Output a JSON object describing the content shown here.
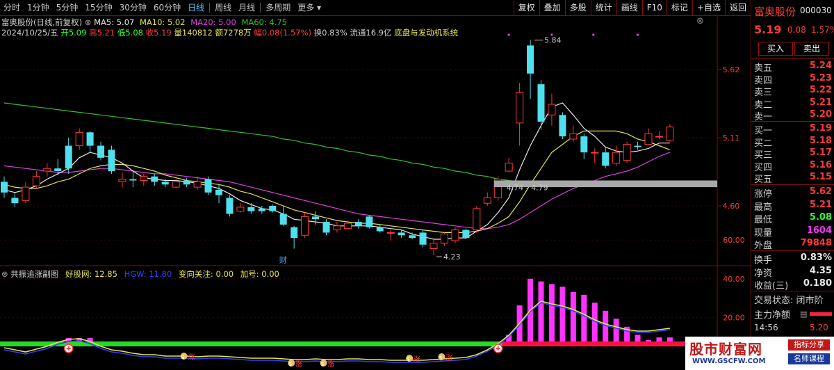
{
  "toolbar": {
    "periods": [
      "分时",
      "1分钟",
      "5分钟",
      "15分钟",
      "30分钟",
      "60分钟",
      "日线",
      "周线",
      "月线",
      "多周期",
      "更多 ▾"
    ],
    "active_index": 6,
    "right_buttons": [
      "复权",
      "叠加",
      "多股",
      "统计",
      "画线",
      "F10",
      "标记",
      "+自选",
      "返回"
    ]
  },
  "info": {
    "stock_title": "富奥股份(日线,前复权)",
    "ma5": "MA5: 5.07",
    "ma10": "MA10: 5.02",
    "ma20": "MA20: 5.00",
    "ma60": "MA60: 4.75",
    "date": "2024/10/25/五",
    "open": "开5.09",
    "high": "高5.21",
    "low": "低5.08",
    "close": "收5.19",
    "volume": "量140812",
    "amount": "额7278万",
    "amplitude": "幅0.08(1.57%)",
    "turnover": "换0.83%",
    "float_cap": "流通16.9亿",
    "system": "底盘与发动机系统"
  },
  "sub_info": {
    "name": "共振追涨副图",
    "value1": "好股网: 12.85",
    "value2": "HGW: 11.80",
    "value3": "变向关注: 0.00",
    "value4": "加号: 0.00"
  },
  "price_axis": [
    "5.62",
    "5.11",
    "4.60"
  ],
  "sub_axis": [
    "60.00",
    "40.00",
    "20.00"
  ],
  "annotations": {
    "high": "5.84",
    "low": "4.23",
    "zone": "4.74 - 4.79",
    "cai": "财",
    "zhang": "涨"
  },
  "panel": {
    "name": "富奥股份",
    "code": "000030",
    "price": "5.19",
    "change": "0.08",
    "pct": "1.57%",
    "buy_btn": "买入",
    "sell_btn": "卖出",
    "asks": [
      [
        "卖五",
        "5.24"
      ],
      [
        "卖四",
        "5.23"
      ],
      [
        "卖三",
        "5.22"
      ],
      [
        "卖二",
        "5.21"
      ],
      [
        "卖一",
        "5.20"
      ]
    ],
    "bids": [
      [
        "买一",
        "5.19"
      ],
      [
        "买二",
        "5.18"
      ],
      [
        "买三",
        "5.17"
      ],
      [
        "买四",
        "5.16"
      ],
      [
        "买五",
        "5.15"
      ]
    ],
    "stats": [
      [
        "涨停",
        "5.62"
      ],
      [
        "最高",
        "5.21"
      ],
      [
        "最低",
        "5.08"
      ],
      [
        "现量",
        "1604"
      ],
      [
        "外盘",
        "79848"
      ]
    ],
    "stats2": [
      [
        "换手",
        "0.83%"
      ],
      [
        "净资",
        "4.35"
      ],
      [
        "收益(三)",
        "0.180"
      ]
    ],
    "trade_status": "交易状态: 闭市阶",
    "main_flow": "主力净额",
    "time": "14:56",
    "time_price": "5.20"
  },
  "watermark": {
    "site": "股市财富网",
    "url": "WWW.GSCFW.COM",
    "tag1": "指标分享",
    "tag2": "名师课程"
  },
  "colors": {
    "up": "#ff3b3b",
    "down": "#4fe0ee",
    "ma5": "#e8e8e8",
    "ma10": "#e6e650",
    "ma20": "#e040e0",
    "ma60": "#30c030"
  }
}
